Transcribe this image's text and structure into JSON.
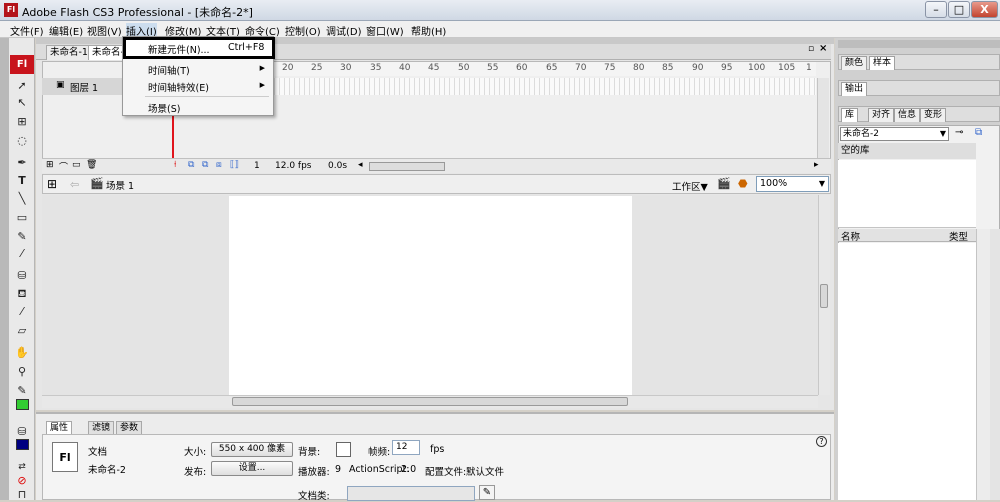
{
  "window": {
    "title": "Adobe Flash CS3 Professional - [未命名-2*]",
    "app_icon": "Fl",
    "min": "–",
    "max": "□",
    "close": "X"
  },
  "menubar": [
    "文件(F)",
    "编辑(E)",
    "视图(V)",
    "插入(I)",
    "修改(M)",
    "文本(T)",
    "命令(C)",
    "控制(O)",
    "调试(D)",
    "窗口(W)",
    "帮助(H)"
  ],
  "insert_menu": {
    "new_symbol": "新建元件(N)...",
    "new_symbol_shortcut": "Ctrl+F8",
    "timeline": "时间轴(T)",
    "timeline_effects": "时间轴特效(E)",
    "scene": "场景(S)"
  },
  "doc_tabs": [
    "未命名-1",
    "未命名-"
  ],
  "timeline": {
    "layer_name": "图层 1",
    "ticks": [
      "20",
      "25",
      "30",
      "35",
      "40",
      "45",
      "50",
      "55",
      "60",
      "65",
      "70",
      "75",
      "80",
      "85",
      "90",
      "95",
      "100",
      "105",
      "1"
    ],
    "current_frame": "1",
    "fps": "12.0 fps",
    "time": "0.0s"
  },
  "editbar": {
    "scene": "场景 1",
    "workspace": "工作区▼",
    "zoom": "100%"
  },
  "properties": {
    "tabs": [
      "属性",
      "滤镜",
      "参数"
    ],
    "doc_label": "文档",
    "doc_name": "未命名-2",
    "size_label": "大小:",
    "size_value": "550 x 400 像素",
    "bg_label": "背景:",
    "framerate_label": "帧频:",
    "framerate_value": "12",
    "fps_unit": "fps",
    "publish_label": "发布:",
    "settings_button": "设置...",
    "player_label": "播放器:",
    "player_value": "9",
    "actionscript_label": "ActionScript:",
    "actionscript_value": "2.0",
    "profile_label": "配置文件:",
    "profile_value": "默认文件",
    "docclass_label": "文档类:",
    "doc_icon": "Fl",
    "help": "?"
  },
  "right_panels": {
    "tabs1": [
      "颜色",
      "样本"
    ],
    "tabs2": [
      "输出"
    ],
    "tabs3": [
      "库",
      "对齐",
      "信息",
      "变形"
    ],
    "library_select": "未命名-2",
    "library_empty": "空的库",
    "col_name": "名称",
    "col_type": "类型"
  },
  "colors": {
    "flash_red": "#c8141c",
    "stroke_swatch": "#000080",
    "fill_swatch": "#33cc33"
  }
}
